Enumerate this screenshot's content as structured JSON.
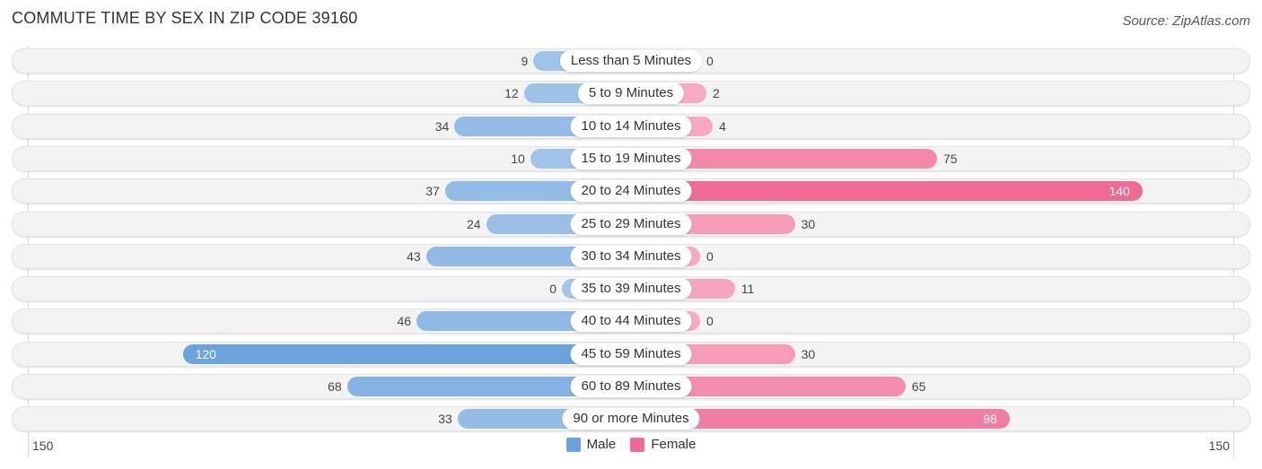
{
  "header": {
    "title": "COMMUTE TIME BY SEX IN ZIP CODE 39160",
    "source": "Source: ZipAtlas.com"
  },
  "colors": {
    "male": "#6ba3dc",
    "male_light": "#a4c6ea",
    "female": "#f06a96",
    "female_light": "#f7aac2"
  },
  "chart_data": {
    "type": "bar",
    "orientation": "horizontal-diverging",
    "title": "COMMUTE TIME BY SEX IN ZIP CODE 39160",
    "categories": [
      "Less than 5 Minutes",
      "5 to 9 Minutes",
      "10 to 14 Minutes",
      "15 to 19 Minutes",
      "20 to 24 Minutes",
      "25 to 29 Minutes",
      "30 to 34 Minutes",
      "35 to 39 Minutes",
      "40 to 44 Minutes",
      "45 to 59 Minutes",
      "60 to 89 Minutes",
      "90 or more Minutes"
    ],
    "series": [
      {
        "name": "Male",
        "values": [
          9,
          12,
          34,
          10,
          37,
          24,
          43,
          0,
          46,
          120,
          68,
          33
        ]
      },
      {
        "name": "Female",
        "values": [
          0,
          2,
          4,
          75,
          140,
          30,
          0,
          11,
          0,
          30,
          65,
          98
        ]
      }
    ],
    "axis": {
      "left_label": "150",
      "right_label": "150",
      "max": 150
    },
    "legend": {
      "position": "bottom-center",
      "items": [
        "Male",
        "Female"
      ]
    }
  }
}
